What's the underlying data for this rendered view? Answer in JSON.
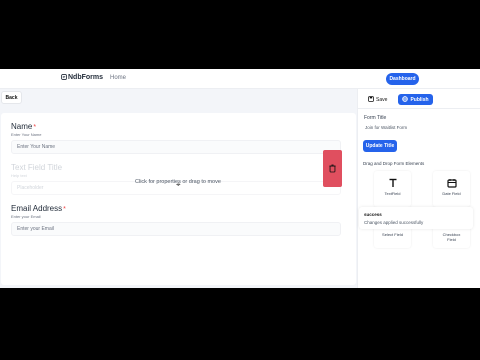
{
  "nav": {
    "brand": "NdbForms",
    "home": "Home",
    "dashboard": "Dashboard"
  },
  "canvas": {
    "back": "Back",
    "hover_hint": "Click for properties or drag to move",
    "fields": [
      {
        "label": "Name",
        "required": "*",
        "help": "Enter Your Name",
        "placeholder": "Enter Your Name"
      },
      {
        "label": "Text Field Title",
        "required": "",
        "help": "Help text",
        "placeholder": "Placeholder"
      },
      {
        "label": "Email Address",
        "required": "*",
        "help": "Enter your Email",
        "placeholder": "Enter your Email"
      }
    ]
  },
  "panel": {
    "save": "Save",
    "publish": "Publish",
    "form_title_label": "Form Title",
    "form_title_value": "Join for Waitlist Form",
    "update_title": "Update Title",
    "dnd_label": "Drag and Drop Form Elements",
    "tiles": [
      {
        "label": "TextField",
        "icon": "text-icon"
      },
      {
        "label": "Date Field",
        "icon": "calendar-icon"
      },
      {
        "label": "Select Field",
        "icon": "list-icon"
      },
      {
        "label": "Checkbox Field",
        "icon": "checkbox-icon"
      }
    ],
    "toast": {
      "title": "success",
      "message": "Changes applied successfully"
    }
  },
  "colors": {
    "accent": "#2563eb",
    "danger": "#e04f5f",
    "required": "#ef4444",
    "canvas_bg": "#f3f5f9"
  }
}
